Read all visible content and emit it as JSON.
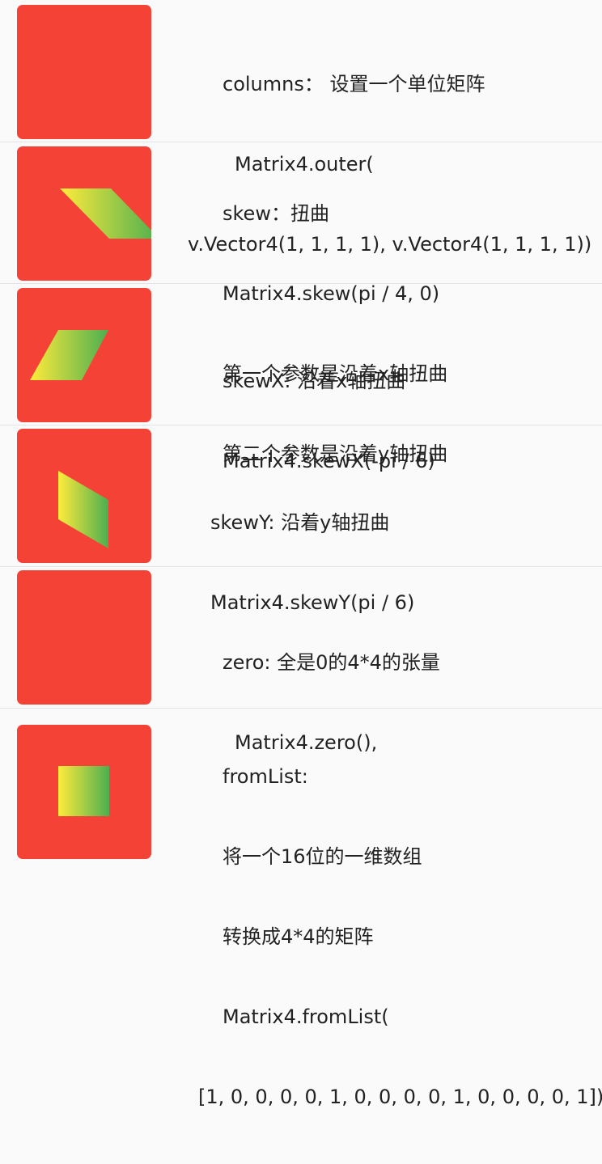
{
  "colors": {
    "box": "#f44336",
    "gradient_start": "#ffeb3b",
    "gradient_end": "#4caf50",
    "background": "#fafafa",
    "divider": "#e4e4e4"
  },
  "rows": [
    {
      "lines": [
        "columns： 设置一个单位矩阵",
        "Matrix4.outer(",
        "v.Vector4(1, 1, 1, 1), v.Vector4(1, 1, 1, 1))"
      ]
    },
    {
      "lines": [
        "skew：扭曲",
        "Matrix4.skew(pi / 4, 0)",
        "第一个参数是沿着x轴扭曲",
        "第二个参数是沿着y轴扭曲"
      ]
    },
    {
      "lines": [
        "skewX: 沿着x轴扭曲",
        "Matrix4.skewX(-pi / 6)"
      ]
    },
    {
      "lines": [
        "skewY: 沿着y轴扭曲",
        "Matrix4.skewY(pi / 6)"
      ]
    },
    {
      "lines": [
        "zero: 全是0的4*4的张量",
        "Matrix4.zero(),"
      ]
    },
    {
      "lines": [
        "fromList:",
        "将一个16位的一维数组",
        "转换成4*4的矩阵",
        "Matrix4.fromList(",
        "[1, 0, 0, 0, 0, 1, 0, 0, 0, 0, 1, 0, 0, 0, 0, 1])"
      ]
    }
  ]
}
